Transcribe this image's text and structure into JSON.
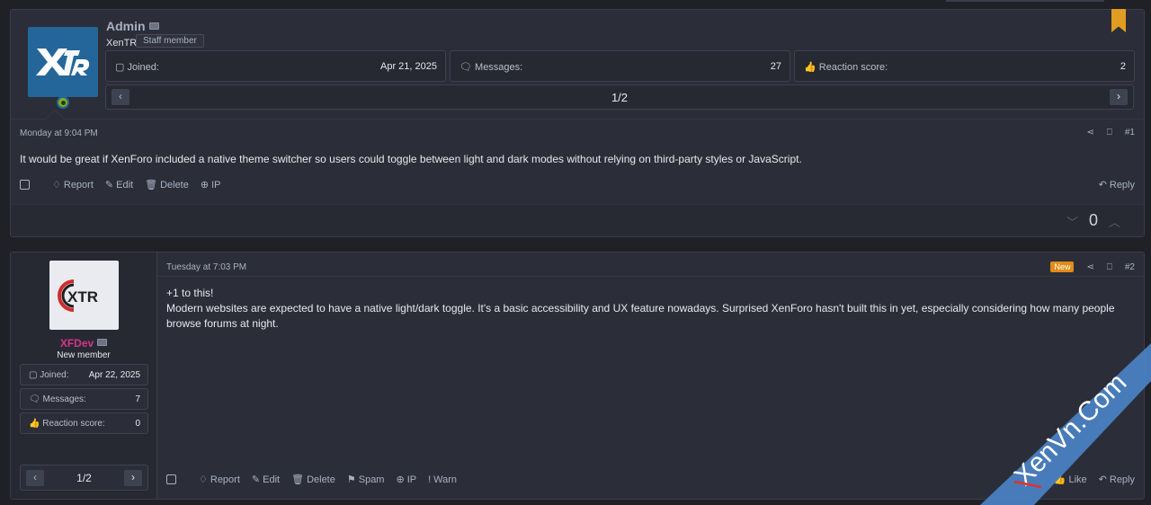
{
  "post1": {
    "username": "Admin",
    "user_title": "XenTR",
    "badge": "Staff member",
    "stats": [
      {
        "label": "Joined:",
        "value": "Apr 21, 2025",
        "icon": "calendar-icon"
      },
      {
        "label": "Messages:",
        "value": "27",
        "icon": "messages-icon"
      },
      {
        "label": "Reaction score:",
        "value": "2",
        "icon": "thumbs-up-icon"
      }
    ],
    "pager": "1/2",
    "date": "Monday at 9:04 PM",
    "number": "#1",
    "body": "It would be great if XenForo included a native theme switcher so users could toggle between light and dark modes without relying on third-party styles or JavaScript.",
    "actions": {
      "report": "Report",
      "edit": "Edit",
      "delete": "Delete",
      "ip": "IP",
      "reply": "Reply"
    },
    "vote_score": "0"
  },
  "post2": {
    "username": "XFDev",
    "user_title": "New member",
    "stats": [
      {
        "label": "Joined:",
        "value": "Apr 22, 2025",
        "icon": "calendar-icon"
      },
      {
        "label": "Messages:",
        "value": "7",
        "icon": "messages-icon"
      },
      {
        "label": "Reaction score:",
        "value": "0",
        "icon": "thumbs-up-icon"
      }
    ],
    "pager": "1/2",
    "date": "Tuesday at 7:03 PM",
    "new_badge": "New",
    "number": "#2",
    "body_line1": "+1 to this!",
    "body_line2": "Modern websites are expected to have a native light/dark toggle. It's a basic accessibility and UX feature nowadays. Surprised XenForo hasn't built this in yet, especially considering how many people browse forums at night.",
    "actions": {
      "report": "Report",
      "edit": "Edit",
      "delete": "Delete",
      "spam": "Spam",
      "ip": "IP",
      "warn": "Warn",
      "like": "Like",
      "reply": "Reply"
    }
  },
  "logos": {
    "xtr": "XTR"
  },
  "watermark": "XenVn.Com",
  "colors": {
    "accent": "#e19d21",
    "post_bg": "#2b2e38",
    "page_bg": "#1f2127",
    "username2": "#d6338b"
  }
}
